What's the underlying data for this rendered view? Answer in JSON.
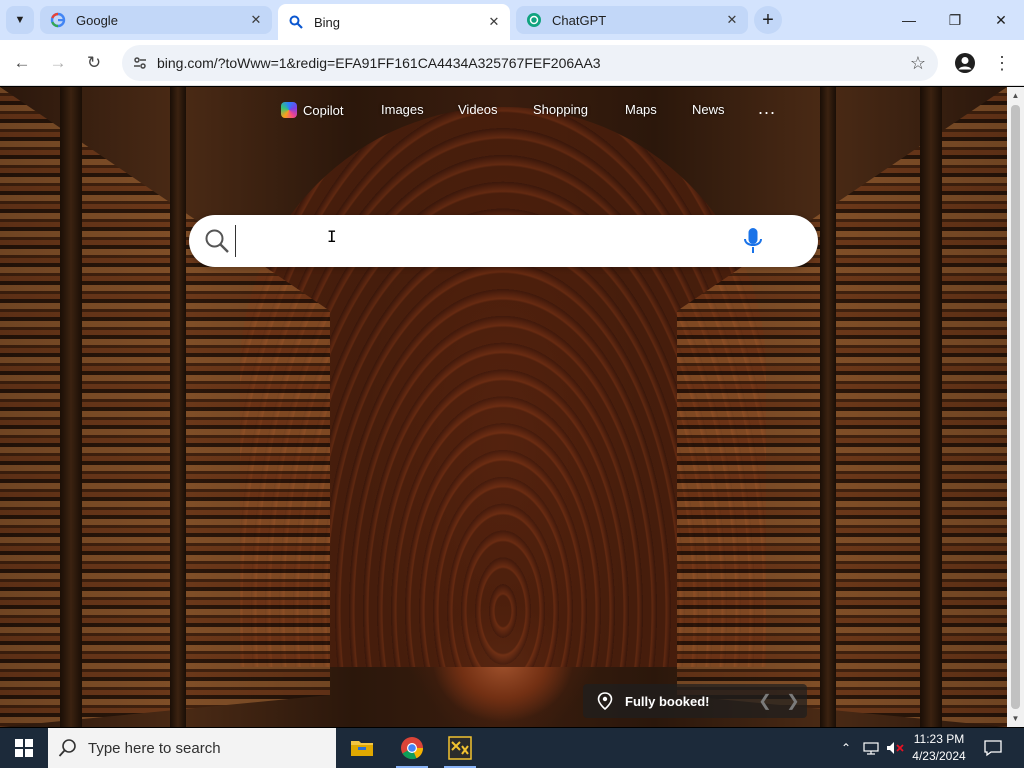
{
  "browser": {
    "tabs": [
      {
        "title": "Google",
        "icon": "google-favicon"
      },
      {
        "title": "Bing",
        "icon": "bing-search-favicon",
        "active": true
      },
      {
        "title": "ChatGPT",
        "icon": "chatgpt-favicon"
      }
    ],
    "url": "bing.com/?toWww=1&redig=EFA91FF161CA4434A325767FEF206AA3"
  },
  "bing": {
    "nav": {
      "copilot": "Copilot",
      "images": "Images",
      "videos": "Videos",
      "shopping": "Shopping",
      "maps": "Maps",
      "news": "News",
      "more": "..."
    },
    "search": {
      "value": "",
      "placeholder": ""
    },
    "caption": "Fully booked!"
  },
  "taskbar": {
    "search_placeholder": "Type here to search",
    "time": "11:23 PM",
    "date": "4/23/2024"
  },
  "colors": {
    "tabbar": "#d3e3fd",
    "taskbar": "#1c2a3a",
    "accent": "#0b57d0"
  }
}
